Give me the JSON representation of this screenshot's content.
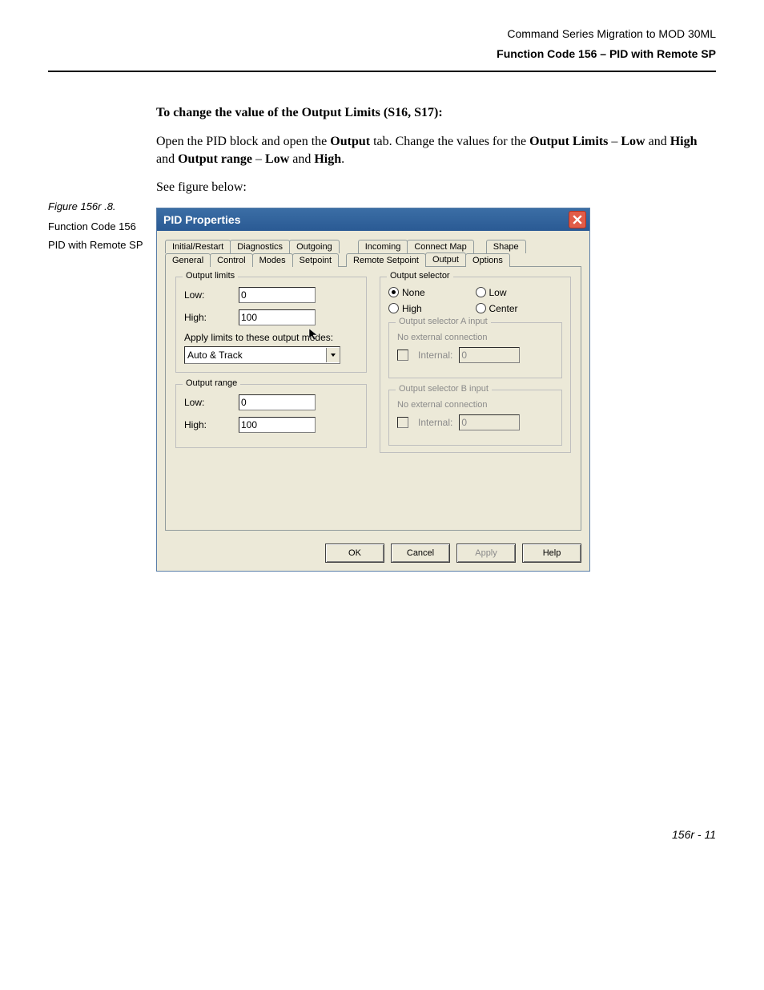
{
  "header": {
    "line1": "Command Series Migration to MOD 30ML",
    "line2": "Function Code 156 – PID with Remote SP"
  },
  "body": {
    "heading": "To change the value of the Output Limits (S16, S17):",
    "para1_a": "Open the PID block and open the ",
    "para1_b": "Output",
    "para1_c": " tab. Change the values for the ",
    "para1_d": "Output Limits",
    "para1_e": " – ",
    "para1_f": "Low",
    "para1_g": " and ",
    "para1_h": "High",
    "para1_i": " and ",
    "para1_j": "Output range",
    "para1_k": " – ",
    "para1_l": "Low",
    "para1_m": " and ",
    "para1_n": "High",
    "para1_o": ".",
    "see": "See figure below:"
  },
  "sidebar": {
    "fig": "Figure 156r .8.",
    "t1": "Function Code 156",
    "t2": "PID with Remote SP"
  },
  "dialog": {
    "title": "PID Properties",
    "tabs_row1": [
      "Initial/Restart",
      "Diagnostics",
      "Outgoing",
      "Incoming",
      "Connect Map",
      "Shape"
    ],
    "tabs_row2": [
      "General",
      "Control",
      "Modes",
      "Setpoint",
      "Remote Setpoint",
      "Output",
      "Options"
    ],
    "active_tab": "Output",
    "output_limits": {
      "legend": "Output limits",
      "low_label": "Low:",
      "low_value": "0",
      "high_label": "High:",
      "high_value": "100",
      "apply_label": "Apply limits to these output modes:",
      "combo_value": "Auto & Track"
    },
    "output_range": {
      "legend": "Output range",
      "low_label": "Low:",
      "low_value": "0",
      "high_label": "High:",
      "high_value": "100"
    },
    "output_selector": {
      "legend": "Output selector",
      "opt_none": "None",
      "opt_low": "Low",
      "opt_high": "High",
      "opt_center": "Center",
      "selected": "None",
      "a": {
        "legend": "Output selector A input",
        "noconn": "No external connection",
        "internal_label": "Internal:",
        "internal_value": "0"
      },
      "b": {
        "legend": "Output selector B input",
        "noconn": "No external connection",
        "internal_label": "Internal:",
        "internal_value": "0"
      }
    },
    "buttons": {
      "ok": "OK",
      "cancel": "Cancel",
      "apply": "Apply",
      "help": "Help"
    }
  },
  "footer": "156r - 11"
}
